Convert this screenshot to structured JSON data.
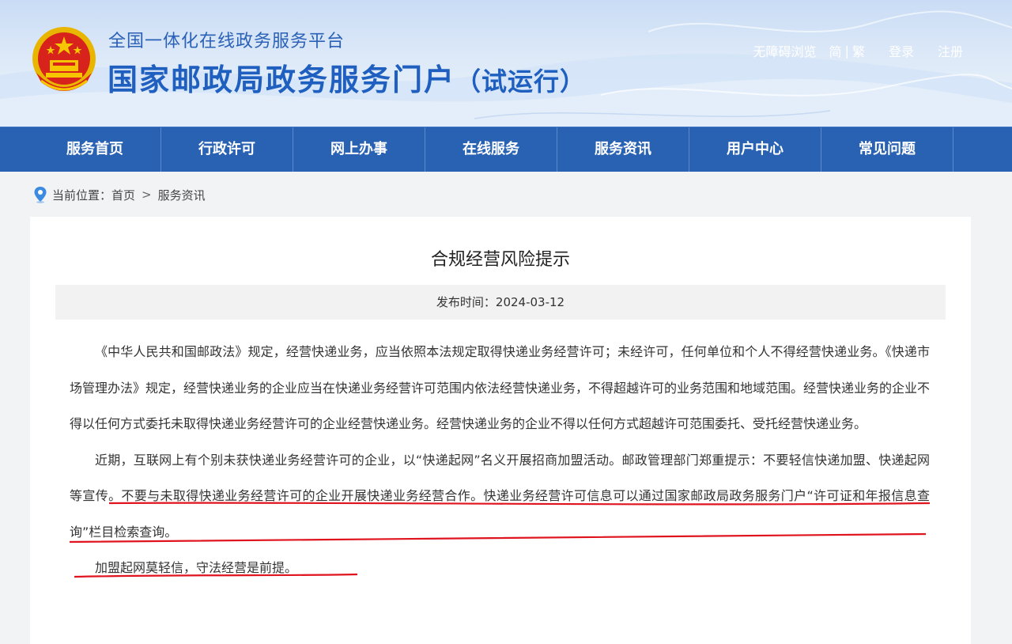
{
  "header": {
    "subtitle": "全国一体化在线政务服务平台",
    "title": "国家邮政局政务服务门户",
    "title_suffix": "（试运行）",
    "emblem_icon": "national-emblem-icon",
    "links": {
      "accessibility": "无障碍浏览",
      "simplified": "简",
      "separator": "|",
      "traditional": "繁",
      "login": "登录",
      "register": "注册"
    }
  },
  "nav": {
    "items": [
      {
        "label": "服务首页"
      },
      {
        "label": "行政许可"
      },
      {
        "label": "网上办事"
      },
      {
        "label": "在线服务"
      },
      {
        "label": "服务资讯"
      },
      {
        "label": "用户中心"
      },
      {
        "label": "常见问题"
      }
    ]
  },
  "breadcrumb": {
    "prefix": "当前位置：",
    "home": "首页",
    "separator": ">",
    "current": "服务资讯",
    "icon": "location-pin-icon"
  },
  "article": {
    "title": "合规经营风险提示",
    "publish_label": "发布时间：",
    "publish_date": "2024-03-12",
    "paragraphs": [
      "《中华人民共和国邮政法》规定，经营快递业务，应当依照本法规定取得快递业务经营许可；未经许可，任何单位和个人不得经营快递业务。《快递市场管理办法》规定，经营快递业务的企业应当在快递业务经营许可范围内依法经营快递业务，不得超越许可的业务范围和地域范围。经营快递业务的企业不得以任何方式委托未取得快递业务经营许可的企业经营快递业务。经营快递业务的企业不得以任何方式超越许可范围委托、受托经营快递业务。",
      "近期，互联网上有个别未获快递业务经营许可的企业，以“快递起网”名义开展招商加盟活动。邮政管理部门郑重提示：不要轻信快递加盟、快递起网等宣传。不要与未取得快递业务经营许可的企业开展快递业务经营合作。快递业务经营许可信息可以通过国家邮政局政务服务门户“许可证和年报信息查询”栏目检索查询。",
      "加盟起网莫轻信，守法经营是前提。"
    ]
  },
  "colors": {
    "nav_bg": "#2a62b3",
    "title_blue": "#1f5fbf",
    "annotation_red": "#e0141e"
  }
}
